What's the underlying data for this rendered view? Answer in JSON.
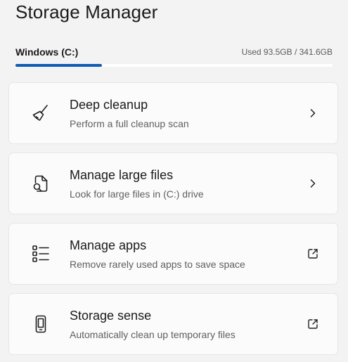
{
  "page": {
    "title": "Storage Manager"
  },
  "drive": {
    "name": "Windows (C:)",
    "usage_text": "Used 93.5GB / 341.6GB",
    "used_fraction": 0.2737,
    "accent_color": "#0f5bb5"
  },
  "cards": [
    {
      "title": "Deep cleanup",
      "subtitle": "Perform a full cleanup scan",
      "icon": "broom-icon",
      "action_icon": "chevron-right-icon"
    },
    {
      "title": "Manage large files",
      "subtitle": "Look for large files in (C:) drive",
      "icon": "file-search-icon",
      "action_icon": "chevron-right-icon"
    },
    {
      "title": "Manage apps",
      "subtitle": "Remove rarely used apps to save space",
      "icon": "app-list-icon",
      "action_icon": "open-external-icon"
    },
    {
      "title": "Storage sense",
      "subtitle": "Automatically clean up temporary files",
      "icon": "phone-device-icon",
      "action_icon": "open-external-icon"
    }
  ]
}
